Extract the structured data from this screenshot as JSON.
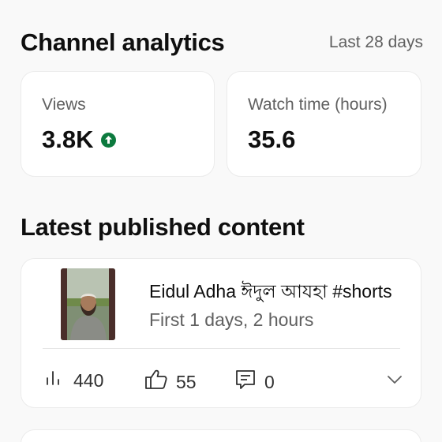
{
  "analytics": {
    "title": "Channel analytics",
    "period": "Last 28 days",
    "views": {
      "label": "Views",
      "value": "3.8K",
      "trend": "up"
    },
    "watch_time": {
      "label": "Watch time (hours)",
      "value": "35.6"
    }
  },
  "latest": {
    "section_title": "Latest published content",
    "video": {
      "title": "Eidul Adha  ঈদুল আযহা #shorts",
      "age": "First 1 days, 2 hours",
      "views": "440",
      "likes": "55",
      "comments": "0"
    }
  },
  "colors": {
    "trend_up": "#0c7a3e",
    "muted_text": "#606060"
  }
}
